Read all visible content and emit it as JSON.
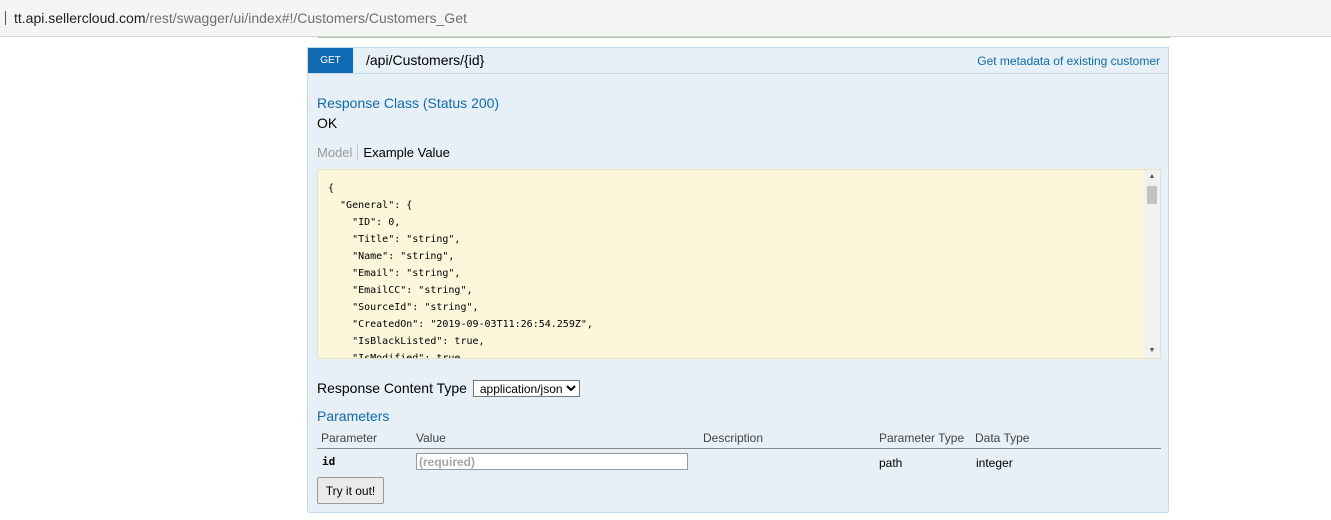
{
  "browser": {
    "url_host": "tt.api.sellercloud.com",
    "url_path": "/rest/swagger/ui/index#!/Customers/Customers_Get"
  },
  "operation": {
    "method": "GET",
    "path": "/api/Customers/{id}",
    "summary": "Get metadata of existing customer",
    "response_class_label": "Response Class (Status 200)",
    "response_status_text": "OK",
    "tabs": {
      "model": "Model",
      "example": "Example Value"
    },
    "example_json": "{\n  \"General\": {\n    \"ID\": 0,\n    \"Title\": \"string\",\n    \"Name\": \"string\",\n    \"Email\": \"string\",\n    \"EmailCC\": \"string\",\n    \"SourceId\": \"string\",\n    \"CreatedOn\": \"2019-09-03T11:26:54.259Z\",\n    \"IsBlackListed\": true,\n    \"IsModified\": true",
    "response_content_type_label": "Response Content Type",
    "response_content_type_value": "application/json",
    "parameters_heading": "Parameters",
    "parameter_columns": {
      "parameter": "Parameter",
      "value": "Value",
      "description": "Description",
      "parameter_type": "Parameter Type",
      "data_type": "Data Type"
    },
    "parameters": [
      {
        "name": "id",
        "placeholder": "(required)",
        "description": "",
        "param_type": "path",
        "data_type": "integer"
      }
    ],
    "try_button": "Try it out!"
  },
  "colors": {
    "method_get": "#0f6ab4",
    "panel_bg": "#e7f0f7",
    "snippet_bg": "#fcf6db"
  }
}
